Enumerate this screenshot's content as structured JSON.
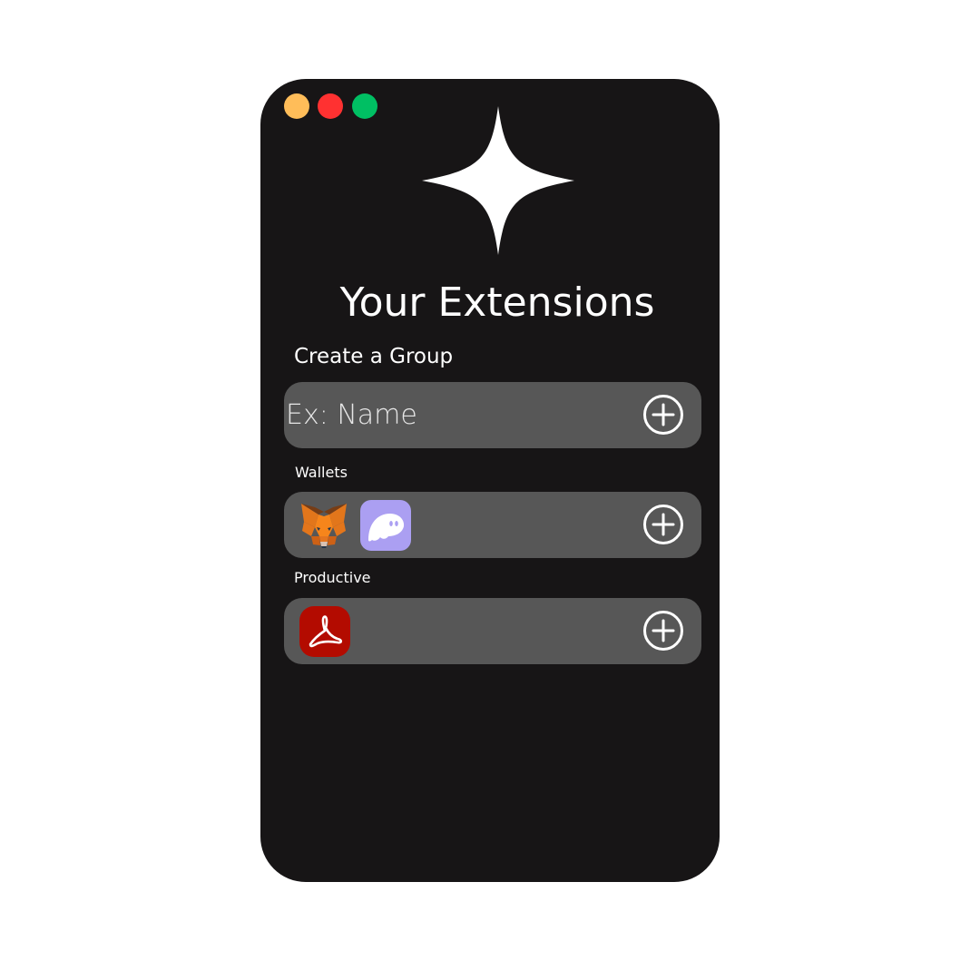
{
  "window": {
    "controls": [
      {
        "name": "minimize",
        "color": "#ffbd59"
      },
      {
        "name": "close",
        "color": "#ff3131"
      },
      {
        "name": "maximize",
        "color": "#00bf63"
      }
    ],
    "logo_icon": "sparkle-icon"
  },
  "header": {
    "title": "Your Extensions"
  },
  "create_group": {
    "label": "Create a Group",
    "input_placeholder": "Ex: Name",
    "input_value": "",
    "add_icon": "plus-circle-icon"
  },
  "groups": [
    {
      "label": "Wallets",
      "extensions": [
        {
          "name": "MetaMask",
          "icon": "metamask-fox-icon"
        },
        {
          "name": "Phantom",
          "icon": "phantom-ghost-icon"
        }
      ],
      "add_icon": "plus-circle-icon"
    },
    {
      "label": "Productive",
      "extensions": [
        {
          "name": "Adobe Acrobat",
          "icon": "adobe-acrobat-icon"
        }
      ],
      "add_icon": "plus-circle-icon"
    }
  ],
  "colors": {
    "window_background": "#171516",
    "bar_background": "#575757",
    "text": "#ffffff",
    "page_background": "#ffffff"
  }
}
